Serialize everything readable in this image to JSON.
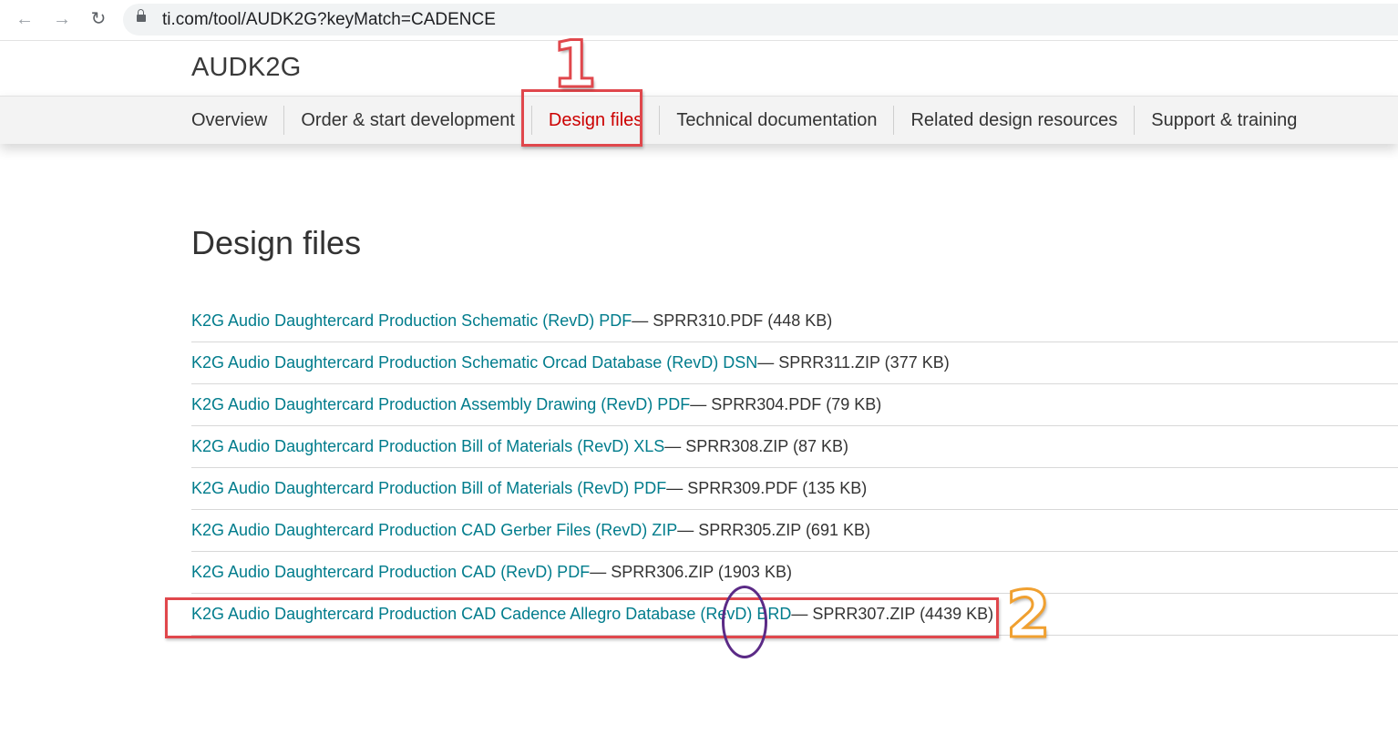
{
  "browser": {
    "back_icon": "back-arrow-icon",
    "forward_icon": "forward-arrow-icon",
    "reload_icon": "reload-icon",
    "lock_icon": "lock-icon",
    "url": "ti.com/tool/AUDK2G?keyMatch=CADENCE"
  },
  "header": {
    "product_title": "AUDK2G"
  },
  "tabs": [
    {
      "label": "Overview",
      "active": false
    },
    {
      "label": "Order & start development",
      "active": false
    },
    {
      "label": "Design files",
      "active": true
    },
    {
      "label": "Technical documentation",
      "active": false
    },
    {
      "label": "Related design resources",
      "active": false
    },
    {
      "label": "Support & training",
      "active": false
    }
  ],
  "main": {
    "section_title": "Design files",
    "files": [
      {
        "link": "K2G Audio Daughtercard Production Schematic (RevD) PDF",
        "meta": " — SPRR310.PDF (448 KB)"
      },
      {
        "link": "K2G Audio Daughtercard Production Schematic Orcad Database (RevD) DSN",
        "meta": " — SPRR311.ZIP (377 KB)"
      },
      {
        "link": "K2G Audio Daughtercard Production Assembly Drawing (RevD) PDF",
        "meta": " — SPRR304.PDF (79 KB)"
      },
      {
        "link": "K2G Audio Daughtercard Production Bill of Materials (RevD) XLS",
        "meta": " — SPRR308.ZIP (87 KB)"
      },
      {
        "link": "K2G Audio Daughtercard Production Bill of Materials (RevD) PDF",
        "meta": " — SPRR309.PDF (135 KB)"
      },
      {
        "link": "K2G Audio Daughtercard Production CAD Gerber Files (RevD) ZIP",
        "meta": " — SPRR305.ZIP (691 KB)"
      },
      {
        "link": "K2G Audio Daughtercard Production CAD (RevD) PDF",
        "meta": " — SPRR306.ZIP (1903 KB)"
      },
      {
        "link": "K2G Audio Daughtercard Production CAD Cadence Allegro Database (RevD) BRD",
        "meta": " — SPRR307.ZIP (4439 KB)"
      }
    ]
  },
  "annotations": {
    "step_one": "1",
    "step_two": "2",
    "box_color": "#e0474c",
    "ellipse_color": "#5b2a86",
    "step_two_color": "#f0a030"
  },
  "colors": {
    "link": "#007c8c",
    "active_tab": "#cc0000",
    "text": "#333333"
  }
}
